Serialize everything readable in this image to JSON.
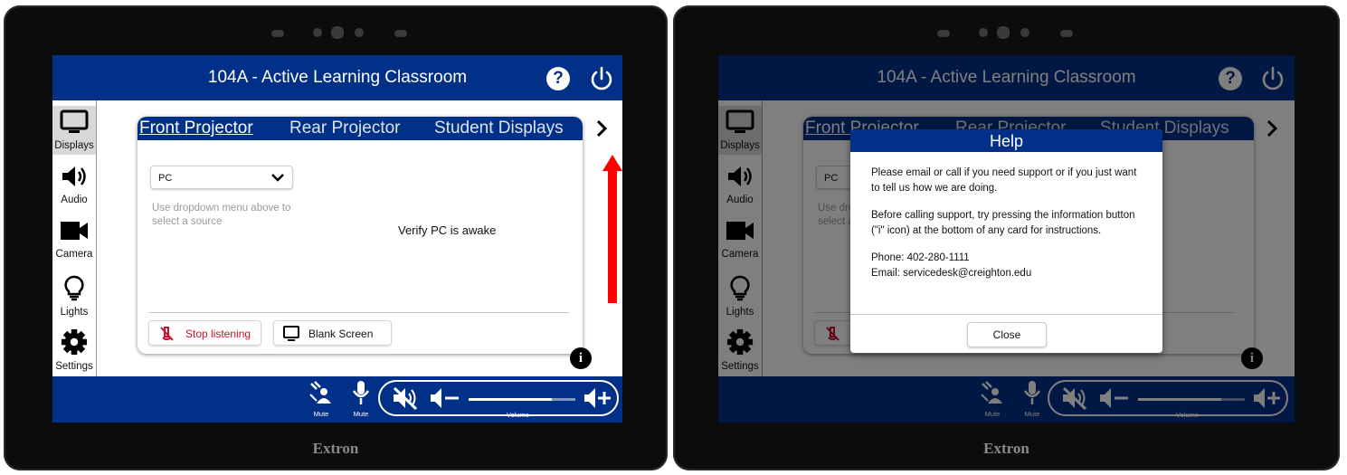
{
  "screen": {
    "title": "104A - Active Learning Classroom",
    "help_icon": "?",
    "brand": "Extron",
    "sidebar": [
      {
        "label": "Displays",
        "icon": "monitor-icon",
        "active": true
      },
      {
        "label": "Audio",
        "icon": "speaker-icon"
      },
      {
        "label": "Camera",
        "icon": "video-camera-icon"
      },
      {
        "label": "Lights",
        "icon": "lightbulb-icon"
      },
      {
        "label": "Settings",
        "icon": "gear-icon"
      }
    ],
    "tabs": [
      "Front Projector",
      "Rear Projector",
      "Student Displays"
    ],
    "source_selected": "PC",
    "hint": "Use dropdown menu above to select a source",
    "status": "Verify PC is awake",
    "stop_listening": "Stop listening",
    "blank_screen": "Blank Screen",
    "info_icon": "i",
    "footer": {
      "mute1": "Mute",
      "mute2": "Mute",
      "volume_label": "Volume",
      "volume_level": 0.78
    }
  },
  "screen2_tabs": [
    "Front Projector",
    "Rear Projector",
    "Student Displays"
  ],
  "modal": {
    "title": "Help",
    "p1": "Please email or call if you need support or if you just want to tell us how we are doing.",
    "p2": "Before calling support, try pressing the information button (\"i\" icon) at the bottom of any card for instructions.",
    "phone": "Phone: 402-280-1111",
    "email": "Email: servicedesk@creighton.edu",
    "close": "Close"
  },
  "colors": {
    "brand_blue": "#003087",
    "annotation_arrow": "#ff0000",
    "stop_red": "#d0021b"
  }
}
